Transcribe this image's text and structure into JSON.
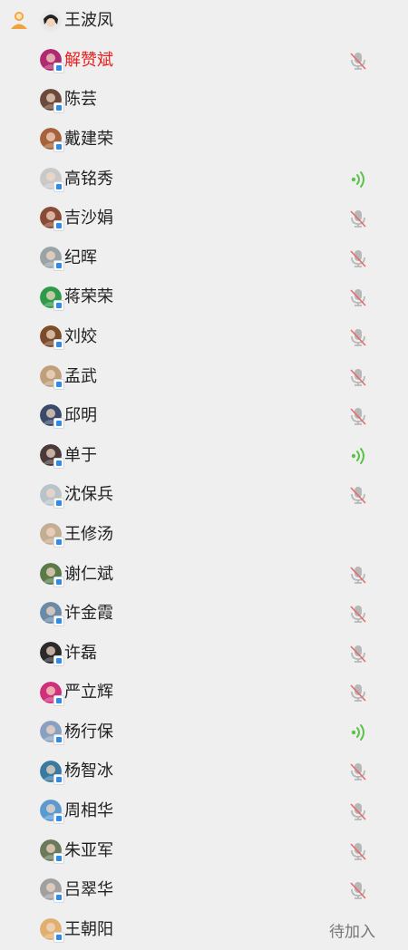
{
  "host": {
    "name": "王波凤",
    "avatar": "avatar-host",
    "role_icon": "user-icon"
  },
  "members": [
    {
      "name": "解赞斌",
      "color": "#b02a6f",
      "red": true,
      "status": "muted"
    },
    {
      "name": "陈芸",
      "color": "#6b4a3a",
      "red": false,
      "status": "none"
    },
    {
      "name": "戴建荣",
      "color": "#a6623a",
      "red": false,
      "status": "none"
    },
    {
      "name": "高铭秀",
      "color": "#c9c9c9",
      "red": false,
      "status": "speaking"
    },
    {
      "name": "吉沙娟",
      "color": "#8a4b36",
      "red": false,
      "status": "muted"
    },
    {
      "name": "纪晖",
      "color": "#9aa3a6",
      "red": false,
      "status": "muted"
    },
    {
      "name": "蒋荣荣",
      "color": "#2f9a4a",
      "red": false,
      "status": "muted"
    },
    {
      "name": "刘姣",
      "color": "#7a4c2a",
      "red": false,
      "status": "muted"
    },
    {
      "name": "孟武",
      "color": "#c0a07a",
      "red": false,
      "status": "muted"
    },
    {
      "name": "邱明",
      "color": "#3a4a6a",
      "red": false,
      "status": "muted"
    },
    {
      "name": "单于",
      "color": "#4a3a3a",
      "red": false,
      "status": "speaking"
    },
    {
      "name": "沈保兵",
      "color": "#b8c4ca",
      "red": false,
      "status": "muted"
    },
    {
      "name": "王修汤",
      "color": "#c4ad94",
      "red": false,
      "status": "none"
    },
    {
      "name": "谢仁斌",
      "color": "#5a7a4a",
      "red": false,
      "status": "muted"
    },
    {
      "name": "许金霞",
      "color": "#6a8aa6",
      "red": false,
      "status": "muted"
    },
    {
      "name": "许磊",
      "color": "#2a2a2a",
      "red": false,
      "status": "muted"
    },
    {
      "name": "严立辉",
      "color": "#d0307a",
      "red": false,
      "status": "muted"
    },
    {
      "name": "杨行保",
      "color": "#8aa0c0",
      "red": false,
      "status": "speaking"
    },
    {
      "name": "杨智冰",
      "color": "#3a7aa0",
      "red": false,
      "status": "muted"
    },
    {
      "name": "周相华",
      "color": "#5a9ad0",
      "red": false,
      "status": "muted"
    },
    {
      "name": "朱亚军",
      "color": "#6a7a5a",
      "red": false,
      "status": "muted"
    },
    {
      "name": "吕翠华",
      "color": "#a0a0a0",
      "red": false,
      "status": "muted"
    },
    {
      "name": "王朝阳",
      "color": "#e0b070",
      "red": false,
      "status": "pending",
      "status_text": "待加入"
    }
  ],
  "icons": {
    "muted": "mic-muted-icon",
    "speaking": "speaking-icon"
  }
}
